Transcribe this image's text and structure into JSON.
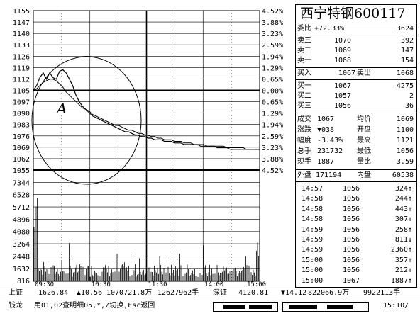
{
  "chart_data": {
    "type": "line",
    "annotation_label": "A",
    "price_axis_left": [
      "1155",
      "1147",
      "1140",
      "1133",
      "1126",
      "1119",
      "1112",
      "1105",
      "1097",
      "1090",
      "1083",
      "1076",
      "1069",
      "1062",
      "1055"
    ],
    "pct_axis_right": [
      "4.52%",
      "3.88%",
      "3.23%",
      "2.59%",
      "1.94%",
      "1.29%",
      "0.65%",
      "0.00%",
      "0.65%",
      "1.29%",
      "1.94%",
      "2.59%",
      "3.23%",
      "3.88%",
      "4.52%"
    ],
    "volume_axis_left": [
      "7344",
      "6528",
      "5712",
      "4896",
      "4080",
      "3264",
      "2448",
      "1632",
      "816"
    ],
    "time_axis": [
      "09:30",
      "10:30",
      "11:30",
      "14:00",
      "15:00"
    ],
    "price_series": [
      1105,
      1108,
      1113,
      1116,
      1112,
      1116,
      1113,
      1112,
      1117,
      1118,
      1116,
      1112,
      1108,
      1102,
      1098,
      1095,
      1093,
      1091,
      1089,
      1088,
      1087,
      1086,
      1085,
      1084,
      1083,
      1082,
      1081,
      1080,
      1079,
      1079,
      1078,
      1077,
      1077,
      1076,
      1076,
      1075,
      1075,
      1074,
      1074,
      1074,
      1073,
      1073,
      1073,
      1072,
      1072,
      1072,
      1071,
      1071,
      1071,
      1071,
      1071,
      1070,
      1070,
      1070,
      1070,
      1070,
      1069,
      1069,
      1069,
      1069,
      1068,
      1068,
      1068,
      1068,
      1068,
      1068,
      1068,
      1068,
      1068,
      1068
    ],
    "avg_series": [
      1105,
      1106,
      1108,
      1110,
      1111,
      1112,
      1112,
      1111,
      1109,
      1107,
      1104,
      1102,
      1100,
      1098,
      1096,
      1094,
      1093,
      1092,
      1090,
      1089,
      1088,
      1087,
      1086,
      1085,
      1084,
      1083,
      1083,
      1082,
      1081,
      1080,
      1080,
      1079,
      1078,
      1078,
      1077,
      1077,
      1076,
      1076,
      1075,
      1075,
      1074,
      1074,
      1074,
      1073,
      1073,
      1073,
      1072,
      1072,
      1072,
      1071,
      1071,
      1071,
      1071,
      1070,
      1070,
      1070,
      1070,
      1070,
      1070,
      1069,
      1069,
      1069,
      1069,
      1069,
      1069,
      1068,
      1068,
      1068,
      1068,
      1068
    ],
    "ylim": [
      1055,
      1155
    ],
    "vol_max": 8160
  },
  "panel": {
    "stock_title": "西宁特钢600117",
    "weibi_label": "委比",
    "weibi_value": "+72.33%",
    "weicha_value": "3624",
    "sell_rows": [
      {
        "label": "卖三",
        "price": "1070",
        "qty": "392"
      },
      {
        "label": "卖二",
        "price": "1069",
        "qty": "147"
      },
      {
        "label": "卖一",
        "price": "1068",
        "qty": "154"
      }
    ],
    "buyin_label": "买入",
    "buyin_price": "1067",
    "sellout_label": "卖出",
    "sellout_price": "1068",
    "buy_rows": [
      {
        "label": "买一",
        "price": "1067",
        "qty": "4275"
      },
      {
        "label": "买二",
        "price": "1057",
        "qty": "2"
      },
      {
        "label": "买三",
        "price": "1056",
        "qty": "36"
      }
    ],
    "stats": [
      {
        "l1": "成交",
        "v1": "1067",
        "l2": "均价",
        "v2": "1069"
      },
      {
        "l1": "涨跌",
        "v1": "▼038",
        "l2": "开盘",
        "v2": "1100"
      },
      {
        "l1": "幅度",
        "v1": "-3.43%",
        "l2": "最高",
        "v2": "1121"
      },
      {
        "l1": "总手",
        "v1": "231732",
        "l2": "最低",
        "v2": "1056"
      },
      {
        "l1": "现手",
        "v1": "1887",
        "l2": "量比",
        "v2": "3.59"
      }
    ],
    "waipan_label": "外盘",
    "waipan_value": "171194",
    "neipan_label": "内盘",
    "neipan_value": "60538",
    "ticks": [
      {
        "t": "14:57",
        "p": "1056",
        "v": "324↑"
      },
      {
        "t": "14:58",
        "p": "1056",
        "v": "244↑"
      },
      {
        "t": "14:58",
        "p": "1056",
        "v": "443↑"
      },
      {
        "t": "14:58",
        "p": "1056",
        "v": "307↑"
      },
      {
        "t": "14:59",
        "p": "1056",
        "v": "258↑"
      },
      {
        "t": "14:59",
        "p": "1056",
        "v": "811↓"
      },
      {
        "t": "14:59",
        "p": "1056",
        "v": "2360↑"
      },
      {
        "t": "15:00",
        "p": "1056",
        "v": "357↑"
      },
      {
        "t": "15:00",
        "p": "1056",
        "v": "212↑"
      },
      {
        "t": "15:00",
        "p": "1067",
        "v": "1887↑"
      }
    ]
  },
  "statusbar": {
    "sh_label": "上证",
    "sh_index": "1626.84",
    "sh_change": "▲10.56",
    "sh_amount": "1070721.8万",
    "sh_volume": "12627962手",
    "sz_label": "深证",
    "sz_index": "4120.81",
    "sz_change": "▼14.12",
    "sz_amount": "822066.9万",
    "sz_volume": "9922113手",
    "brand": "钱龙",
    "hint": "用01,02查明细05,*,/切换,Esc返回",
    "clock": "15:10/"
  }
}
